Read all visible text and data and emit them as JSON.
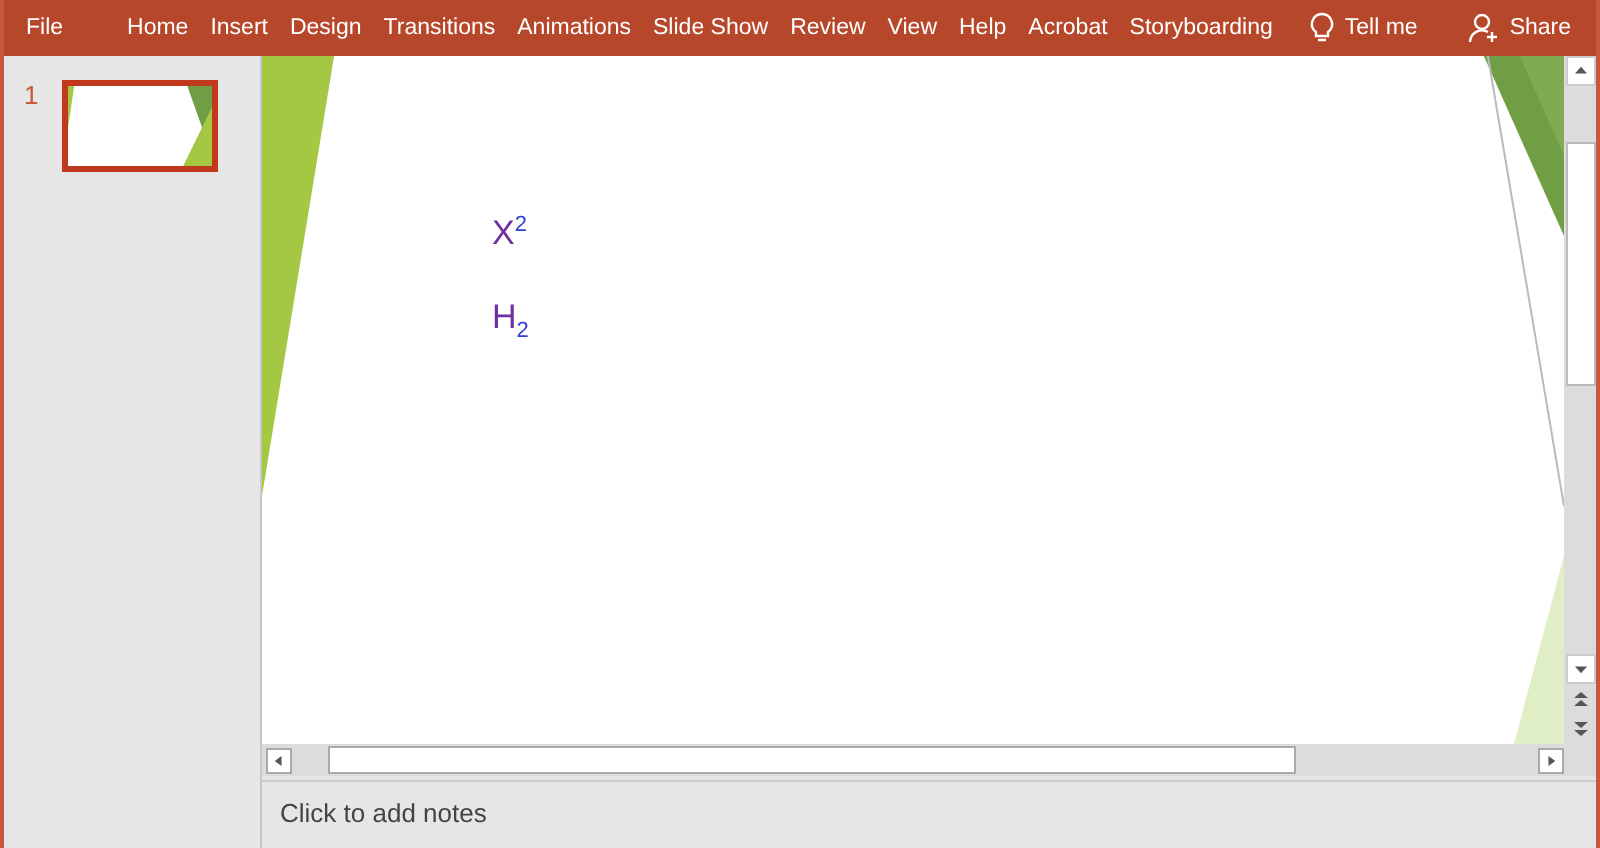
{
  "ribbon": {
    "tabs": [
      {
        "label": "File"
      },
      {
        "label": "Home"
      },
      {
        "label": "Insert"
      },
      {
        "label": "Design"
      },
      {
        "label": "Transitions"
      },
      {
        "label": "Animations"
      },
      {
        "label": "Slide Show"
      },
      {
        "label": "Review"
      },
      {
        "label": "View"
      },
      {
        "label": "Help"
      },
      {
        "label": "Acrobat"
      },
      {
        "label": "Storyboarding"
      }
    ],
    "tell_me": "Tell me",
    "share": "Share"
  },
  "slides": [
    {
      "number": "1",
      "selected": true
    }
  ],
  "slide": {
    "lines": [
      "X$^{2}$",
      "H$_{2}$"
    ]
  },
  "notes": {
    "placeholder": "Click to add notes"
  }
}
